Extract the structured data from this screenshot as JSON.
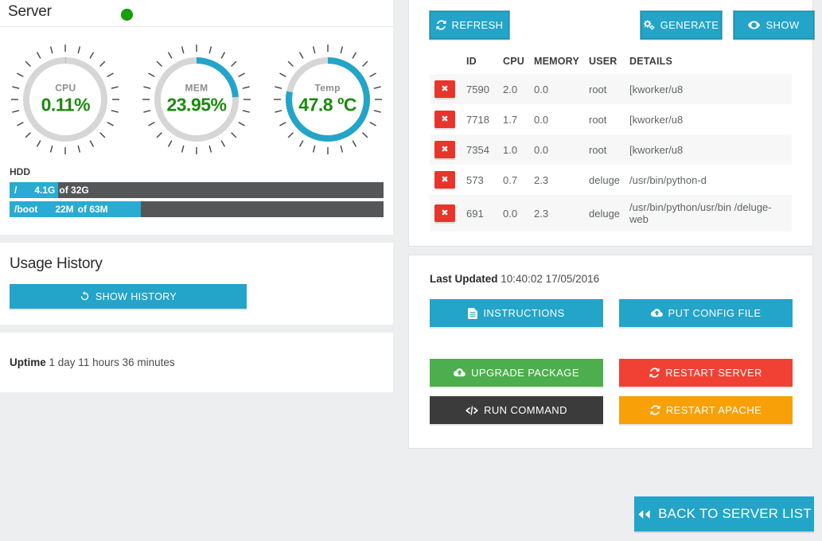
{
  "header": {
    "title": "Server",
    "status_icon": "status-dot-online",
    "status_color": "#17a008"
  },
  "gauges": [
    {
      "label": "CPU",
      "value": "0.11%",
      "percent": 0.11,
      "name": "cpu-gauge"
    },
    {
      "label": "MEM",
      "value": "23.95%",
      "percent": 23.95,
      "name": "mem-gauge"
    },
    {
      "label": "Temp",
      "value": "47.8 ºC",
      "percent": 78,
      "name": "temp-gauge"
    }
  ],
  "hdd": {
    "title": "HDD",
    "disks": [
      {
        "mount": "/",
        "used": "4.1G",
        "of": "of 32G",
        "fill_percent": 13
      },
      {
        "mount": "/boot",
        "used": "22M",
        "of": "of 63M",
        "fill_percent": 35
      }
    ]
  },
  "usage_history": {
    "title": "Usage History",
    "button_label": "SHOW HISTORY",
    "button_icon": "history-icon"
  },
  "uptime": {
    "label": "Uptime",
    "value": "1 day 11 hours 36 minutes"
  },
  "toolbar": {
    "refresh_label": "REFRESH",
    "refresh_icon": "refresh-icon",
    "generate_label": "GENERATE",
    "generate_icon": "cogs-icon",
    "show_label": "SHOW",
    "show_icon": "eye-icon"
  },
  "process_table": {
    "columns": [
      "",
      "ID",
      "CPU",
      "MEMORY",
      "USER",
      "DETAILS"
    ],
    "kill_icon": "close-x-icon",
    "rows": [
      {
        "id": "7590",
        "cpu": "2.0",
        "memory": "0.0",
        "user": "root",
        "details": "[kworker/u8"
      },
      {
        "id": "7718",
        "cpu": "1.7",
        "memory": "0.0",
        "user": "root",
        "details": "[kworker/u8"
      },
      {
        "id": "7354",
        "cpu": "1.0",
        "memory": "0.0",
        "user": "root",
        "details": "[kworker/u8"
      },
      {
        "id": "573",
        "cpu": "0.7",
        "memory": "2.3",
        "user": "deluge",
        "details": "/usr/bin/python-d"
      },
      {
        "id": "691",
        "cpu": "0.0",
        "memory": "2.3",
        "user": "deluge",
        "details": "/usr/bin/python/usr/bin /deluge-web"
      }
    ]
  },
  "last_updated": {
    "label": "Last Updated",
    "value": "10:40:02 17/05/2016"
  },
  "actions": [
    {
      "label": "INSTRUCTIONS",
      "icon": "file-text-icon",
      "color": "#23a4c9",
      "name": "instructions-button"
    },
    {
      "label": "PUT CONFIG FILE",
      "icon": "cloud-upload-icon",
      "color": "#23a4c9",
      "name": "put-config-file-button"
    },
    {
      "label": "UPGRADE PACKAGE",
      "icon": "cloud-upload-icon",
      "color": "#4cae4c",
      "name": "upgrade-package-button"
    },
    {
      "label": "RESTART SERVER",
      "icon": "refresh-icon",
      "color": "#f04134",
      "name": "restart-server-button"
    },
    {
      "label": "RUN COMMAND",
      "icon": "code-icon",
      "color": "#3b3b3b",
      "name": "run-command-button"
    },
    {
      "label": "RESTART APACHE",
      "icon": "refresh-icon",
      "color": "#f7a008",
      "name": "restart-apache-button"
    }
  ],
  "back_button": {
    "label": "BACK TO SERVER LIST",
    "icon": "double-chevron-left-icon"
  }
}
